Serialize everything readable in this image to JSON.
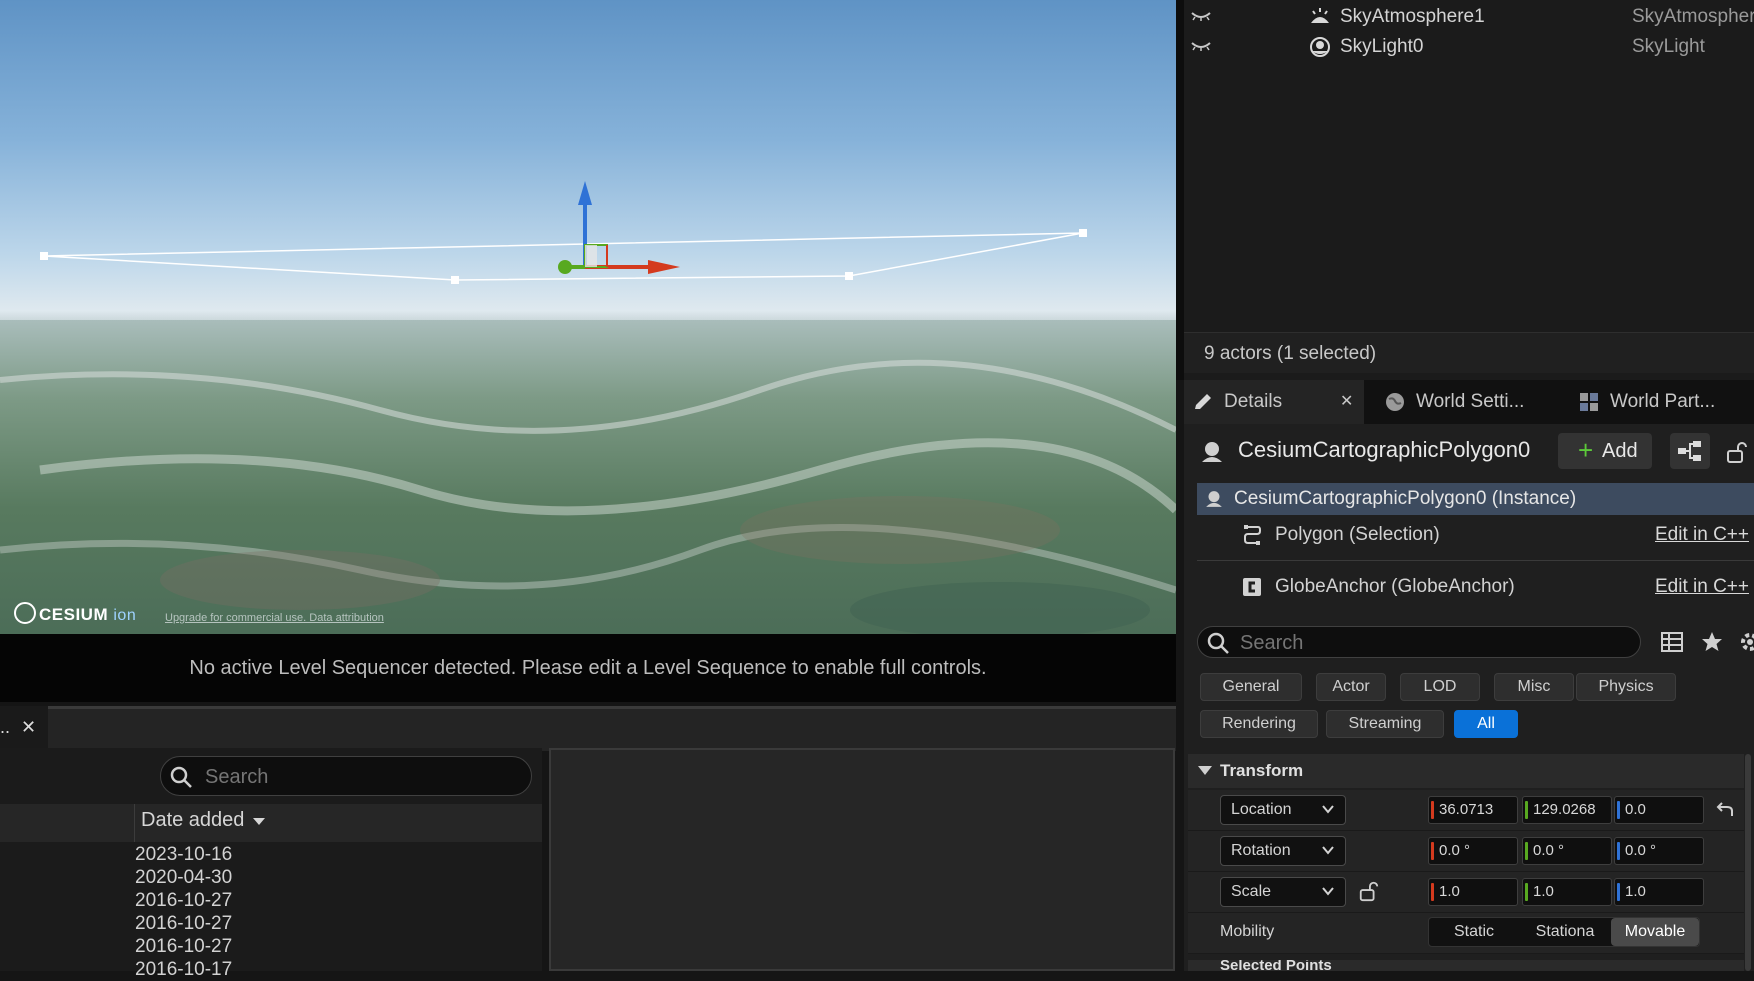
{
  "viewport": {
    "cesium_logo": "CESIUM",
    "cesium_ion": "ion",
    "attribution": "Upgrade for commercial use. Data attribution"
  },
  "sequencer_message": "No active Level Sequencer detected. Please edit a Level Sequence to enable full controls.",
  "content_browser": {
    "tab_label": "..",
    "search_placeholder": "Search",
    "column_date": "Date added",
    "dates": [
      "2023-10-16",
      "2020-04-30",
      "2016-10-27",
      "2016-10-27",
      "2016-10-27",
      "2016-10-17"
    ]
  },
  "outliner": {
    "rows": [
      {
        "name": "SkyAtmosphere1",
        "type": "SkyAtmosphere"
      },
      {
        "name": "SkyLight0",
        "type": "SkyLight"
      }
    ],
    "actor_count": "9 actors (1 selected)"
  },
  "tabs": {
    "details": "Details",
    "world_settings": "World Setti...",
    "world_partition": "World Part..."
  },
  "details": {
    "actor_name": "CesiumCartographicPolygon0",
    "add_label": "Add",
    "instance_label": "CesiumCartographicPolygon0 (Instance)",
    "components": [
      {
        "label": "Polygon (Selection)",
        "edit": "Edit in C++"
      },
      {
        "label": "GlobeAnchor (GlobeAnchor)",
        "edit": "Edit in C++"
      }
    ],
    "search_placeholder": "Search",
    "filters_row1": [
      "General",
      "Actor",
      "LOD",
      "Misc",
      "Physics"
    ],
    "filters_row2": [
      "Rendering",
      "Streaming",
      "All"
    ],
    "transform_header": "Transform",
    "location": {
      "label": "Location",
      "x": "36.0713",
      "y": "129.0268",
      "z": "0.0"
    },
    "rotation": {
      "label": "Rotation",
      "x": "0.0 °",
      "y": "0.0 °",
      "z": "0.0 °"
    },
    "scale": {
      "label": "Scale",
      "x": "1.0",
      "y": "1.0",
      "z": "1.0"
    },
    "mobility": {
      "label": "Mobility",
      "options": [
        "Static",
        "Stationa",
        "Movable"
      ],
      "selected": "Movable"
    },
    "next_section": "Selected Points"
  },
  "colors": {
    "accent": "#0a71d8",
    "selection": "#3d4b5f",
    "axis_x": "#d43a1e",
    "axis_y": "#58a920",
    "axis_z": "#2f72d6"
  }
}
